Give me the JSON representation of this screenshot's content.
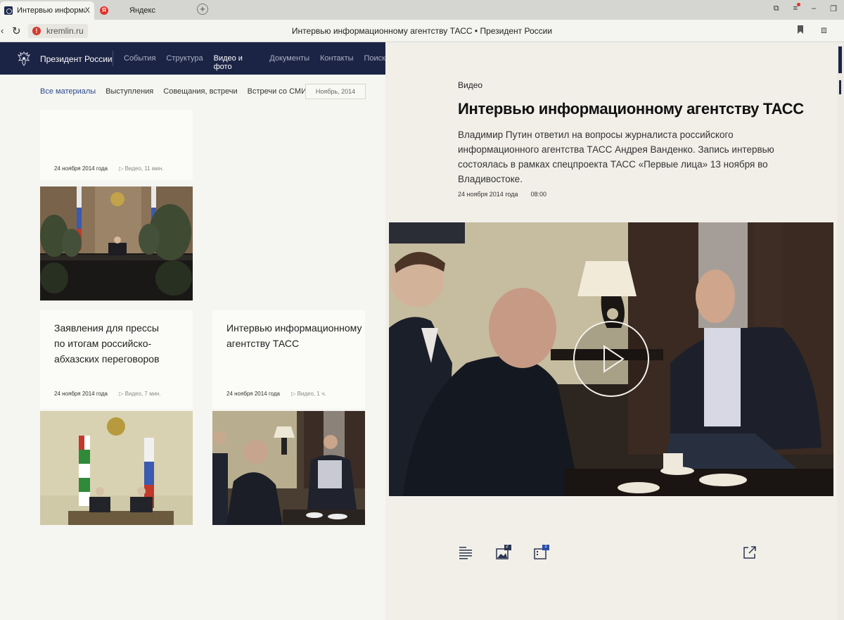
{
  "browser": {
    "tabs": [
      {
        "label": "Интервью информационн",
        "close": "X"
      },
      {
        "label": "Яндекс",
        "favicon_text": "Я"
      }
    ],
    "url": "kremlin.ru",
    "page_title": "Интервью информационному агентству ТАСС • Президент России"
  },
  "site": {
    "name": "Президент России",
    "nav": [
      "События",
      "Структура",
      "Видео и фото",
      "Документы",
      "Контакты",
      "Поиск"
    ],
    "filters": [
      "Все материалы",
      "Выступления",
      "Совещания, встречи",
      "Встречи со СМИ"
    ],
    "date_select": "Ноябрь, 2014",
    "cards": [
      {
        "date": "24 ноября 2014 года",
        "media": "▷ Видео, 11 мин."
      },
      {
        "title_lines": [
          "Заявления для прессы",
          "по итогам российско-",
          "абхазских переговоров"
        ],
        "date": "24 ноября 2014 года",
        "media": "▷ Видео, 7 мин."
      },
      {
        "title_lines": [
          "Интервью информационному",
          "агентству ТАСС"
        ],
        "date": "24 ноября 2014 года",
        "media": "▷ Видео, 1 ч."
      }
    ]
  },
  "article": {
    "section": "Видео",
    "title": "Интервью информационному агентству ТАСС",
    "lead": "Владимир Путин ответил на вопросы журналиста российского информационного агентства ТАСС Андрея Ванденко. Запись интервью состоялась в рамках спецпроекта ТАСС «Первые лица» 13 ноября во Владивостоке.",
    "date": "24 ноября 2014 года",
    "time": "08:00",
    "photo_count": "2",
    "video_count": "1"
  },
  "colors": {
    "navbar": "#1c2445",
    "accent_link": "#2a4a8c",
    "badge": "#2b4fa8"
  },
  "icons": [
    "back-icon",
    "reload-icon",
    "warning-icon",
    "bookmark-icon",
    "extensions-icon",
    "play-icon",
    "text-icon",
    "photo-icon",
    "video-icon",
    "share-icon"
  ]
}
